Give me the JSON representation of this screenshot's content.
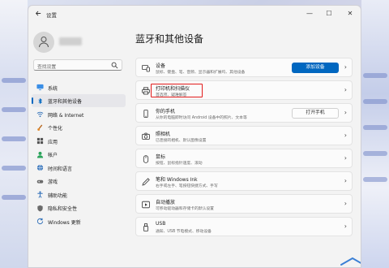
{
  "window": {
    "title": "设置",
    "minimize_glyph": "—",
    "maximize_glyph": "☐",
    "close_glyph": "✕"
  },
  "sidebar": {
    "search_placeholder": "查找设置",
    "items": [
      {
        "label": "系统",
        "icon": "monitor-icon",
        "active": false
      },
      {
        "label": "蓝牙和其他设备",
        "icon": "bluetooth-icon",
        "active": true
      },
      {
        "label": "网络 & Internet",
        "icon": "wifi-icon",
        "active": false
      },
      {
        "label": "个性化",
        "icon": "brush-icon",
        "active": false
      },
      {
        "label": "应用",
        "icon": "apps-icon",
        "active": false
      },
      {
        "label": "帐户",
        "icon": "person-icon",
        "active": false
      },
      {
        "label": "时间和语言",
        "icon": "globe-clock-icon",
        "active": false
      },
      {
        "label": "游戏",
        "icon": "gamepad-icon",
        "active": false
      },
      {
        "label": "辅助功能",
        "icon": "accessibility-icon",
        "active": false
      },
      {
        "label": "隐私和安全性",
        "icon": "shield-icon",
        "active": false
      },
      {
        "label": "Windows 更新",
        "icon": "update-icon",
        "active": false
      }
    ]
  },
  "main": {
    "title": "蓝牙和其他设备",
    "cards": [
      {
        "title": "设备",
        "subtitle": "鼠标、键盘、笔、音频、显示器和扩展坞、其他设备",
        "icon": "devices-icon",
        "button": "添加设备"
      },
      {
        "title": "打印机和扫描仪",
        "subtitle": "首选项、疑难解答",
        "icon": "printer-icon",
        "button": ""
      },
      {
        "title": "你的手机",
        "subtitle": "从你的电脑即时访问 Android 设备中的照片、文本等",
        "icon": "phone-icon",
        "button": "打开手机"
      },
      {
        "title": "照相机",
        "subtitle": "已连接的相机、默认图像设置",
        "icon": "camera-icon",
        "button": ""
      },
      {
        "title": "鼠标",
        "subtitle": "按钮、鼠标指针速度、滚动",
        "icon": "mouse-icon",
        "button": ""
      },
      {
        "title": "笔和 Windows Ink",
        "subtitle": "右手或左手、笔按钮快捷方式、手写",
        "icon": "pen-icon",
        "button": ""
      },
      {
        "title": "自动播放",
        "subtitle": "可移动驱动器和存储卡的默认设置",
        "icon": "autoplay-icon",
        "button": ""
      },
      {
        "title": "USB",
        "subtitle": "通知、USB 节电模式、移动设备",
        "icon": "usb-icon",
        "button": ""
      }
    ]
  },
  "colors": {
    "accent": "#0067c0",
    "highlight_box": "#e21b1b"
  }
}
